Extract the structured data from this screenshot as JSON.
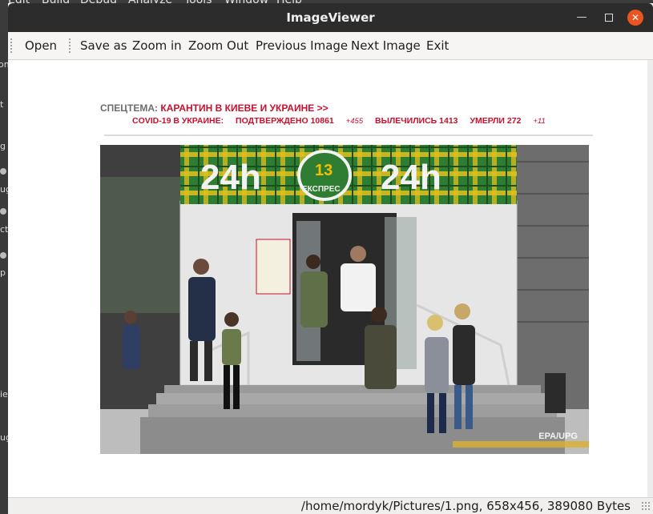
{
  "desktop": {
    "menu_fragments": [
      "Edit",
      "Build",
      "Debug",
      "Analyze",
      "Tools",
      "Window",
      "Help"
    ],
    "side_fragments": [
      "om",
      "t",
      "g",
      "ug",
      "ct",
      "p",
      "iew",
      "ug"
    ]
  },
  "window": {
    "title": "ImageViewer",
    "minimize_glyph": "—",
    "close_glyph": "✕"
  },
  "toolbar": {
    "open": "Open",
    "save_as": "Save as",
    "zoom_in": "Zoom in",
    "zoom_out": "Zoom Out",
    "previous": "Previous Image",
    "next": "Next Image",
    "exit": "Exit"
  },
  "image": {
    "header_label": "СПЕЦТЕМА:",
    "header_link": "КАРАНТИН В КИЕВЕ И УКРАИНЕ >>",
    "covid_label": "COVID-19 В УКРАИНЕ:",
    "confirmed": "ПОДТВЕРЖДЕНО 10861",
    "confirmed_delta": "+455",
    "recovered": "ВЫЛЕЧИЛИСЬ 1413",
    "died": "УМЕРЛИ 272",
    "died_delta": "+11",
    "sign_left": "24h",
    "sign_right": "24h",
    "logo_text": "ЕКСПРЕС",
    "logo_badge": "13",
    "photo_credit": "EPA/UPG"
  },
  "status": {
    "text": "/home/mordyk/Pictures/1.png, 658x456, 389080 Bytes"
  },
  "colors": {
    "titlebar": "#2c2c2c",
    "close_button": "#e95420",
    "accent_red": "#c8102e",
    "awning_green": "#2e7d32",
    "awning_yellow": "#e0c020"
  }
}
